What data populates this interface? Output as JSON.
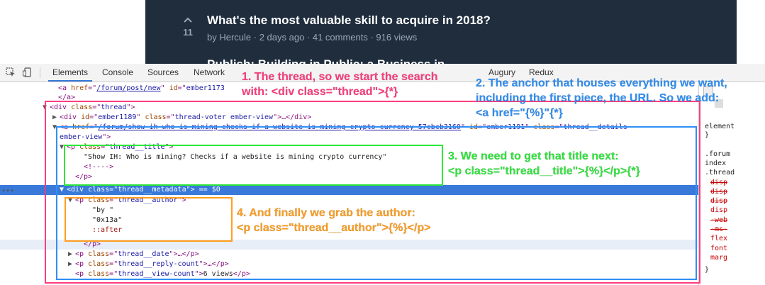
{
  "post": {
    "vote_count": "11",
    "title": "What's the most valuable skill to acquire in 2018?",
    "meta": "by Hercule · 2 days ago · 41 comments · 916 views",
    "next_title": "Publish: Building in Public: a Business in"
  },
  "toolbar": {
    "tabs": [
      "Elements",
      "Console",
      "Sources",
      "Network",
      "Augury",
      "Redux"
    ]
  },
  "dom_lines": [
    {
      "indent": 84,
      "tri": "",
      "parts": [
        [
          "tag",
          "<a "
        ],
        [
          "attr",
          "href"
        ],
        [
          "tag",
          "=\""
        ],
        [
          "link",
          "/forum/post/new"
        ],
        [
          "tag",
          "\" "
        ],
        [
          "attr",
          "id"
        ],
        [
          "tag",
          "=\""
        ],
        [
          "val",
          "ember1173"
        ]
      ]
    },
    {
      "indent": 84,
      "tri": "",
      "parts": [
        [
          "tag",
          "</a>"
        ]
      ]
    },
    {
      "indent": 72,
      "tri": "▼",
      "parts": [
        [
          "tag",
          "<div "
        ],
        [
          "attr",
          "class"
        ],
        [
          "tag",
          "=\""
        ],
        [
          "val",
          "thread"
        ],
        [
          "tag",
          "\">"
        ]
      ]
    },
    {
      "indent": 86,
      "tri": "▶",
      "parts": [
        [
          "tag",
          "<div "
        ],
        [
          "attr",
          "id"
        ],
        [
          "tag",
          "=\""
        ],
        [
          "val",
          "ember1189"
        ],
        [
          "tag",
          "\" "
        ],
        [
          "attr",
          "class"
        ],
        [
          "tag",
          "=\""
        ],
        [
          "val",
          "thread-voter ember-view"
        ],
        [
          "tag",
          "\">…</div>"
        ]
      ]
    },
    {
      "indent": 86,
      "tri": "▼",
      "parts": [
        [
          "tag",
          "<a "
        ],
        [
          "attr",
          "href"
        ],
        [
          "tag",
          "=\""
        ],
        [
          "link",
          "/forum/show-ih-who-is-mining-checks-if-a-website-is-mining-crypto-currency-57cbcb3160"
        ],
        [
          "tag",
          "\" "
        ],
        [
          "attr",
          "id"
        ],
        [
          "tag",
          "=\""
        ],
        [
          "val",
          "ember1191"
        ],
        [
          "tag",
          "\" "
        ],
        [
          "attr",
          "class"
        ],
        [
          "tag",
          "=\""
        ],
        [
          "val",
          "thread__details"
        ]
      ]
    },
    {
      "indent": 86,
      "tri": "",
      "parts": [
        [
          "val",
          "ember-view"
        ],
        [
          "tag",
          "\">"
        ]
      ]
    },
    {
      "indent": 96,
      "tri": "▼",
      "parts": [
        [
          "tag",
          "<p "
        ],
        [
          "attr",
          "class"
        ],
        [
          "tag",
          "=\""
        ],
        [
          "val",
          "thread__title"
        ],
        [
          "tag",
          "\">"
        ]
      ]
    },
    {
      "indent": 120,
      "tri": "",
      "parts": [
        [
          "text",
          "\"Show IH: Who is mining? Checks if a website is mining crypto currency\""
        ]
      ]
    },
    {
      "indent": 120,
      "tri": "",
      "parts": [
        [
          "tag",
          "<!---->"
        ]
      ]
    },
    {
      "indent": 108,
      "tri": "",
      "parts": [
        [
          "tag",
          "</p>"
        ]
      ]
    },
    {
      "indent": 96,
      "tri": "▼",
      "parts": [
        [
          "tag",
          "<div "
        ],
        [
          "attr",
          "class"
        ],
        [
          "tag",
          "=\""
        ],
        [
          "val",
          "thread__metadata"
        ],
        [
          "tag",
          "\">"
        ],
        [
          "text",
          " == $0"
        ]
      ],
      "selected": true
    },
    {
      "indent": 108,
      "tri": "▼",
      "parts": [
        [
          "tag",
          "<p "
        ],
        [
          "attr",
          "class"
        ],
        [
          "tag",
          "=\""
        ],
        [
          "val",
          "thread__author"
        ],
        [
          "tag",
          "\">"
        ]
      ]
    },
    {
      "indent": 132,
      "tri": "",
      "parts": [
        [
          "text",
          "\"by \""
        ]
      ]
    },
    {
      "indent": 132,
      "tri": "",
      "parts": [
        [
          "text",
          "\"0x13a\""
        ]
      ]
    },
    {
      "indent": 132,
      "tri": "",
      "parts": [
        [
          "pseudo",
          "::after"
        ]
      ]
    },
    {
      "indent": 120,
      "tri": "",
      "parts": [
        [
          "tag",
          "</p>"
        ]
      ],
      "hover": true
    },
    {
      "indent": 108,
      "tri": "▶",
      "parts": [
        [
          "tag",
          "<p "
        ],
        [
          "attr",
          "class"
        ],
        [
          "tag",
          "=\""
        ],
        [
          "val",
          "thread__date"
        ],
        [
          "tag",
          "\">…</p>"
        ]
      ]
    },
    {
      "indent": 108,
      "tri": "▶",
      "parts": [
        [
          "tag",
          "<p "
        ],
        [
          "attr",
          "class"
        ],
        [
          "tag",
          "=\""
        ],
        [
          "val",
          "thread__reply-count"
        ],
        [
          "tag",
          "\">…</p>"
        ]
      ]
    },
    {
      "indent": 108,
      "tri": "",
      "parts": [
        [
          "tag",
          "<p "
        ],
        [
          "attr",
          "class"
        ],
        [
          "tag",
          "=\""
        ],
        [
          "val",
          "thread__view-count"
        ],
        [
          "tag",
          "\">"
        ],
        [
          "text",
          "6 views"
        ],
        [
          "tag",
          "</p>"
        ]
      ]
    }
  ],
  "styles_panel": [
    {
      "text": "element",
      "cls": ""
    },
    {
      "text": "}",
      "cls": ""
    },
    {
      "text": ".forum",
      "cls": ""
    },
    {
      "text": "index",
      "cls": ""
    },
    {
      "text": ".thread",
      "cls": ""
    },
    {
      "text": "disp",
      "cls": "strike"
    },
    {
      "text": "disp",
      "cls": "strike"
    },
    {
      "text": "disp",
      "cls": "strike"
    },
    {
      "text": "disp",
      "cls": "prop"
    },
    {
      "text": "-web",
      "cls": "strike"
    },
    {
      "text": "-ms-",
      "cls": "strike"
    },
    {
      "text": "flex",
      "cls": "prop"
    },
    {
      "text": "font",
      "cls": "prop"
    },
    {
      "text": "marg",
      "cls": "prop"
    },
    {
      "text": "}",
      "cls": ""
    }
  ],
  "annotations": {
    "note1": [
      "1. The thread, so we start the search",
      "with: <div class=\"thread\">{*}"
    ],
    "note2": [
      "2. The anchor that houses everything we want,",
      "including the first piece, the URL. So we add:",
      "<a href=\"{%}\"{*}"
    ],
    "note3": [
      "3. We need to get that title next:",
      "<p class=\"thread__title\">{%}</p>{*}"
    ],
    "note4": [
      "4. And finally we grab the author:",
      "<p class=\"thread__author\">{%}</p>"
    ]
  },
  "colors": {
    "pink": "#ff3d7f",
    "blue": "#2f8ff5",
    "green": "#2ee63a",
    "orange": "#ff9e1f"
  }
}
